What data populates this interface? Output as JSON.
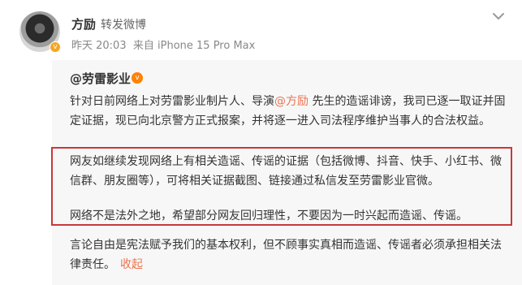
{
  "post": {
    "author": "方励",
    "action_label": "转发微博",
    "timestamp": "昨天 20:03",
    "source": "来自 iPhone 15 Pro Max",
    "avatar_icon": "user-avatar",
    "verified_badge_icon": "verified-badge-icon",
    "menu_icon": "chevron-down-icon"
  },
  "original": {
    "author": "@劳雷影业",
    "verified_icon": "verified-v-icon",
    "para1_before": "针对日前网络上对劳雷影业制片人、导演",
    "para1_mention": "@方励",
    "para1_after": "  先生的造谣诽谤，我司已逐一取证并固定证据，现已向北京警方正式报案，并将逐一进入司法程序维护当事人的合法权益。",
    "para2": "网友如继续发现网络上有相关造谣、传谣的证据（包括微博、抖音、快手、小红书、微信群、朋友圈等），可将相关证据截图、链接通过私信发至劳雷影业官微。",
    "para3": "网络不是法外之地，希望部分网友回归理性，不要因为一时兴起而造谣、传谣。",
    "para4": "言论自由是宪法赋予我们的基本权利，但不顾事实真相而造谣、传谣者必须承担相关法律责任。",
    "collapse_label": "收起"
  },
  "colors": {
    "link": "#eb7350",
    "highlight_border": "#c8393a",
    "repost_bg": "#f7f7f7"
  }
}
